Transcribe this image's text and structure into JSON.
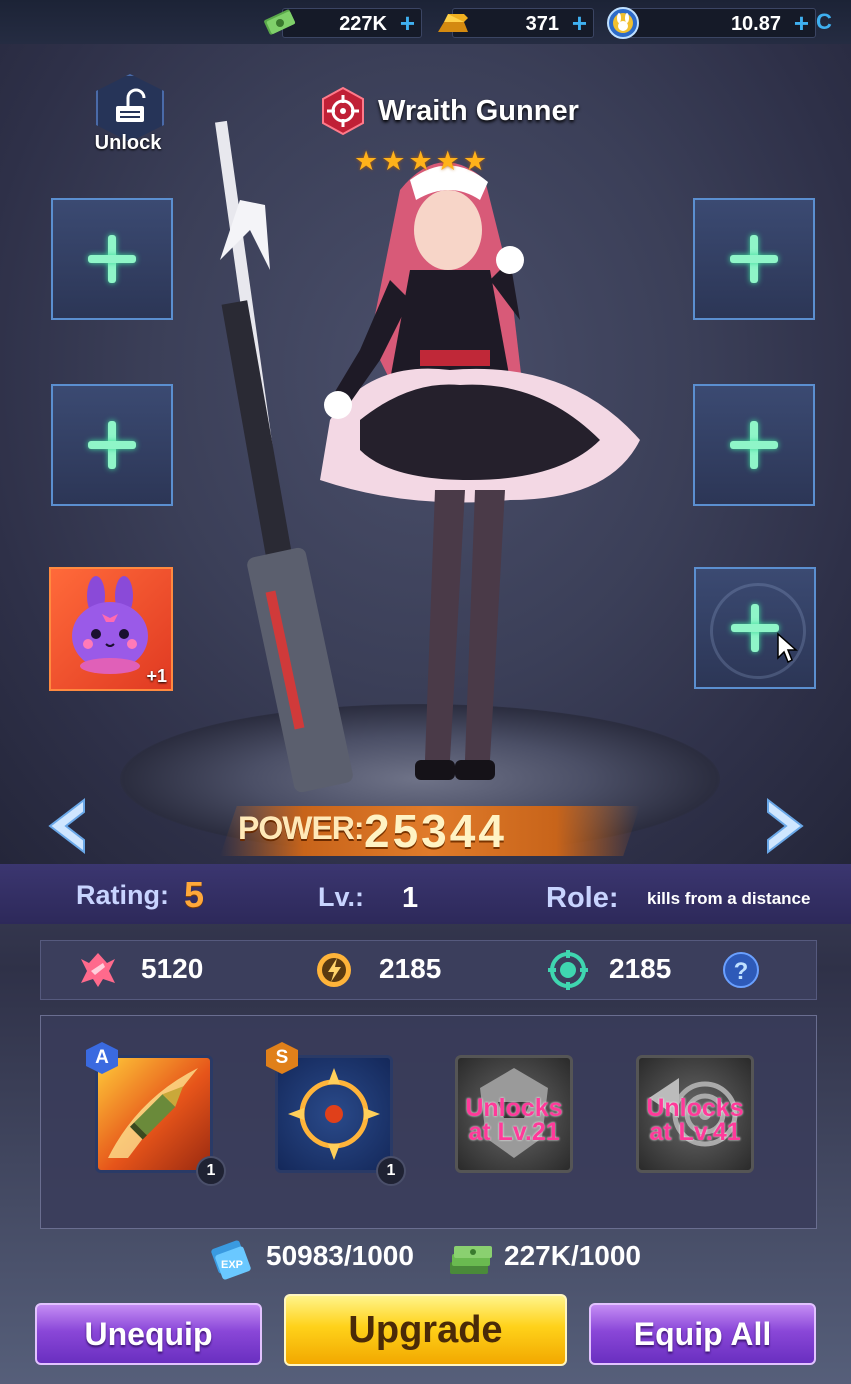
{
  "currencies": [
    {
      "name": "cash",
      "value": "227K",
      "icon": "cash-icon"
    },
    {
      "name": "gold",
      "value": "371",
      "icon": "gold-bar-icon"
    },
    {
      "name": "token",
      "value": "10.87",
      "icon": "bunny-token-icon"
    }
  ],
  "hero": {
    "name": "Wraith Gunner",
    "stars": 5,
    "class_icon": "sniper-crosshair-icon",
    "power_label": "POWER:",
    "power_value": "25344"
  },
  "equip_slots": {
    "unlock_label": "Unlock",
    "pet_badge": "+1"
  },
  "info": {
    "rating_label": "Rating:",
    "rating_value": "5",
    "level_label": "Lv.:",
    "level_value": "1",
    "role_label": "Role:",
    "role_value": "kills from a distance"
  },
  "stats": [
    {
      "icon": "attack-icon",
      "value": "5120",
      "color": "#ff6a8c"
    },
    {
      "icon": "energy-icon",
      "value": "2185",
      "color": "#ffb43a"
    },
    {
      "icon": "defense-icon",
      "value": "2185",
      "color": "#3fd6b0"
    }
  ],
  "skills": [
    {
      "grade": "A",
      "level": "1",
      "icon": "bullet-icon"
    },
    {
      "grade": "S",
      "level": "1",
      "icon": "crosshair-icon"
    },
    {
      "locked_text": "Unlocks at Lv.21",
      "icon": "mech-helmet-icon"
    },
    {
      "locked_text": "Unlocks at Lv.41",
      "icon": "target-icon"
    }
  ],
  "costs": [
    {
      "icon": "exp-card-icon",
      "value": "50983/1000"
    },
    {
      "icon": "cash-stack-icon",
      "value": "227K/1000"
    }
  ],
  "buttons": {
    "unequip": "Unequip",
    "upgrade": "Upgrade",
    "equip_all": "Equip All"
  }
}
